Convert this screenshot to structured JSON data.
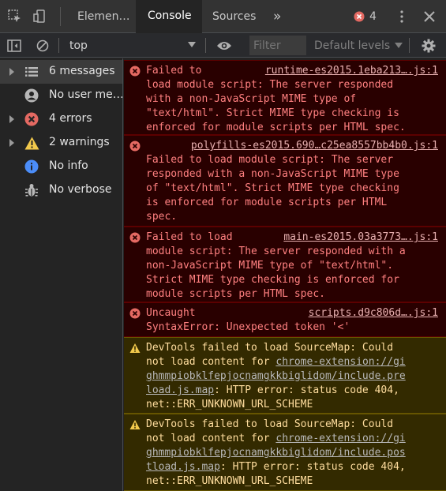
{
  "tabs": {
    "elements": "Elemen…",
    "console": "Console",
    "sources": "Sources",
    "more": "»",
    "error_count": "4"
  },
  "toolbar": {
    "context": "top",
    "filter_placeholder": "Filter",
    "levels": "Default levels"
  },
  "sidebar": {
    "items": [
      {
        "label": "6 messages",
        "icon": "list-icon"
      },
      {
        "label": "No user me…",
        "icon": "user-icon"
      },
      {
        "label": "4 errors",
        "icon": "error-icon"
      },
      {
        "label": "2 warnings",
        "icon": "warning-icon"
      },
      {
        "label": "No info",
        "icon": "info-icon"
      },
      {
        "label": "No verbose",
        "icon": "bug-icon"
      }
    ]
  },
  "messages": [
    {
      "level": "error",
      "source": "runtime-es2015.1eba213….js:1",
      "lines": [
        "Failed to",
        "load module script: The server responded",
        "with a non-JavaScript MIME type of",
        "\"text/html\". Strict MIME type checking is",
        "enforced for module scripts per HTML spec."
      ]
    },
    {
      "level": "error",
      "source": "polyfills-es2015.690…c25ea8557bb4b0.js:1",
      "lines": [
        "",
        "Failed to load module script: The server",
        "responded with a non-JavaScript MIME type",
        "of \"text/html\". Strict MIME type checking",
        "is enforced for module scripts per HTML",
        "spec."
      ]
    },
    {
      "level": "error",
      "source": "main-es2015.03a3773….js:1",
      "lines": [
        "Failed to load",
        "module script: The server responded with a",
        "non-JavaScript MIME type of \"text/html\".",
        "Strict MIME type checking is enforced for",
        "module scripts per HTML spec."
      ]
    },
    {
      "level": "error",
      "source": "scripts.d9c806d….js:1",
      "lines": [
        "Uncaught",
        "SyntaxError: Unexpected token '<'"
      ]
    },
    {
      "level": "warning",
      "text_before": "DevTools failed to load SourceMap: Could\nnot load content for ",
      "link_lines": [
        "chrome-extension://gi",
        "ghmmpiobklfepjocnamgkkbiglidom/include.pre",
        "load.js.map"
      ],
      "text_after": ": HTTP error: status code 404,",
      "last_line": "net::ERR_UNKNOWN_URL_SCHEME"
    },
    {
      "level": "warning",
      "text_before": "DevTools failed to load SourceMap: Could\nnot load content for ",
      "link_lines": [
        "chrome-extension://gi",
        "ghmmpiobklfepjocnamgkkbiglidom/include.pos",
        "tload.js.map"
      ],
      "text_after": ": HTTP error: status code 404,",
      "last_line": "net::ERR_UNKNOWN_URL_SCHEME"
    }
  ],
  "colors": {
    "error_bg": "#290000",
    "error_text": "#ff8080",
    "warning_bg": "#332a00",
    "warning_text": "#ffdd9e",
    "error_icon": "#e46962",
    "warning_icon": "#f2c94c",
    "info_icon": "#4b8df8"
  }
}
